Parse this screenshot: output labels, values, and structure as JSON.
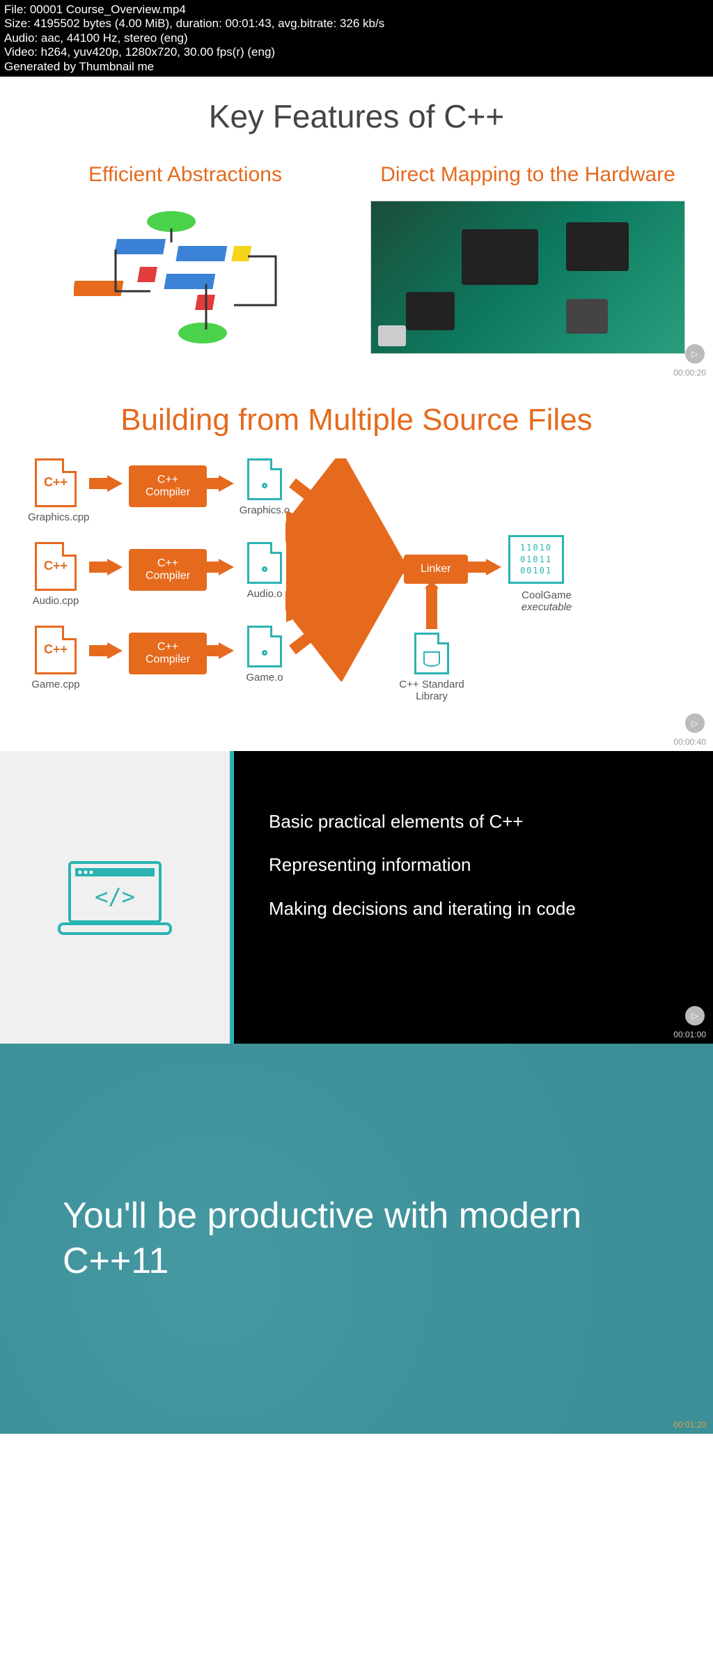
{
  "file_info": {
    "line1": "File: 00001 Course_Overview.mp4",
    "line2": "Size: 4195502 bytes (4.00 MiB), duration: 00:01:43, avg.bitrate: 326 kb/s",
    "line3": "Audio: aac, 44100 Hz, stereo (eng)",
    "line4": "Video: h264, yuv420p, 1280x720, 30.00 fps(r) (eng)",
    "line5": "Generated by Thumbnail me"
  },
  "section1": {
    "title": "Key Features of C++",
    "feature_left": "Efficient Abstractions",
    "feature_right": "Direct Mapping to the Hardware",
    "timestamp": "00:00:20"
  },
  "section2": {
    "title": "Building from Multiple Source Files",
    "cpp_label": "C++",
    "files": {
      "graphics_cpp": "Graphics.cpp",
      "audio_cpp": "Audio.cpp",
      "game_cpp": "Game.cpp",
      "graphics_o": "Graphics.o",
      "audio_o": "Audio.o",
      "game_o": "Game.o"
    },
    "compiler_label": "C++\nCompiler",
    "linker_label": "Linker",
    "stdlib_label": "C++ Standard Library",
    "exe_name": "CoolGame",
    "exe_sub": "executable",
    "timestamp": "00:00:40"
  },
  "section3": {
    "bullet1": "Basic practical elements of C++",
    "bullet2": "Representing information",
    "bullet3": "Making decisions and iterating in code",
    "timestamp": "00:01:00"
  },
  "section4": {
    "heading": "You'll be productive with modern C++11",
    "timestamp": "00:01:20"
  }
}
